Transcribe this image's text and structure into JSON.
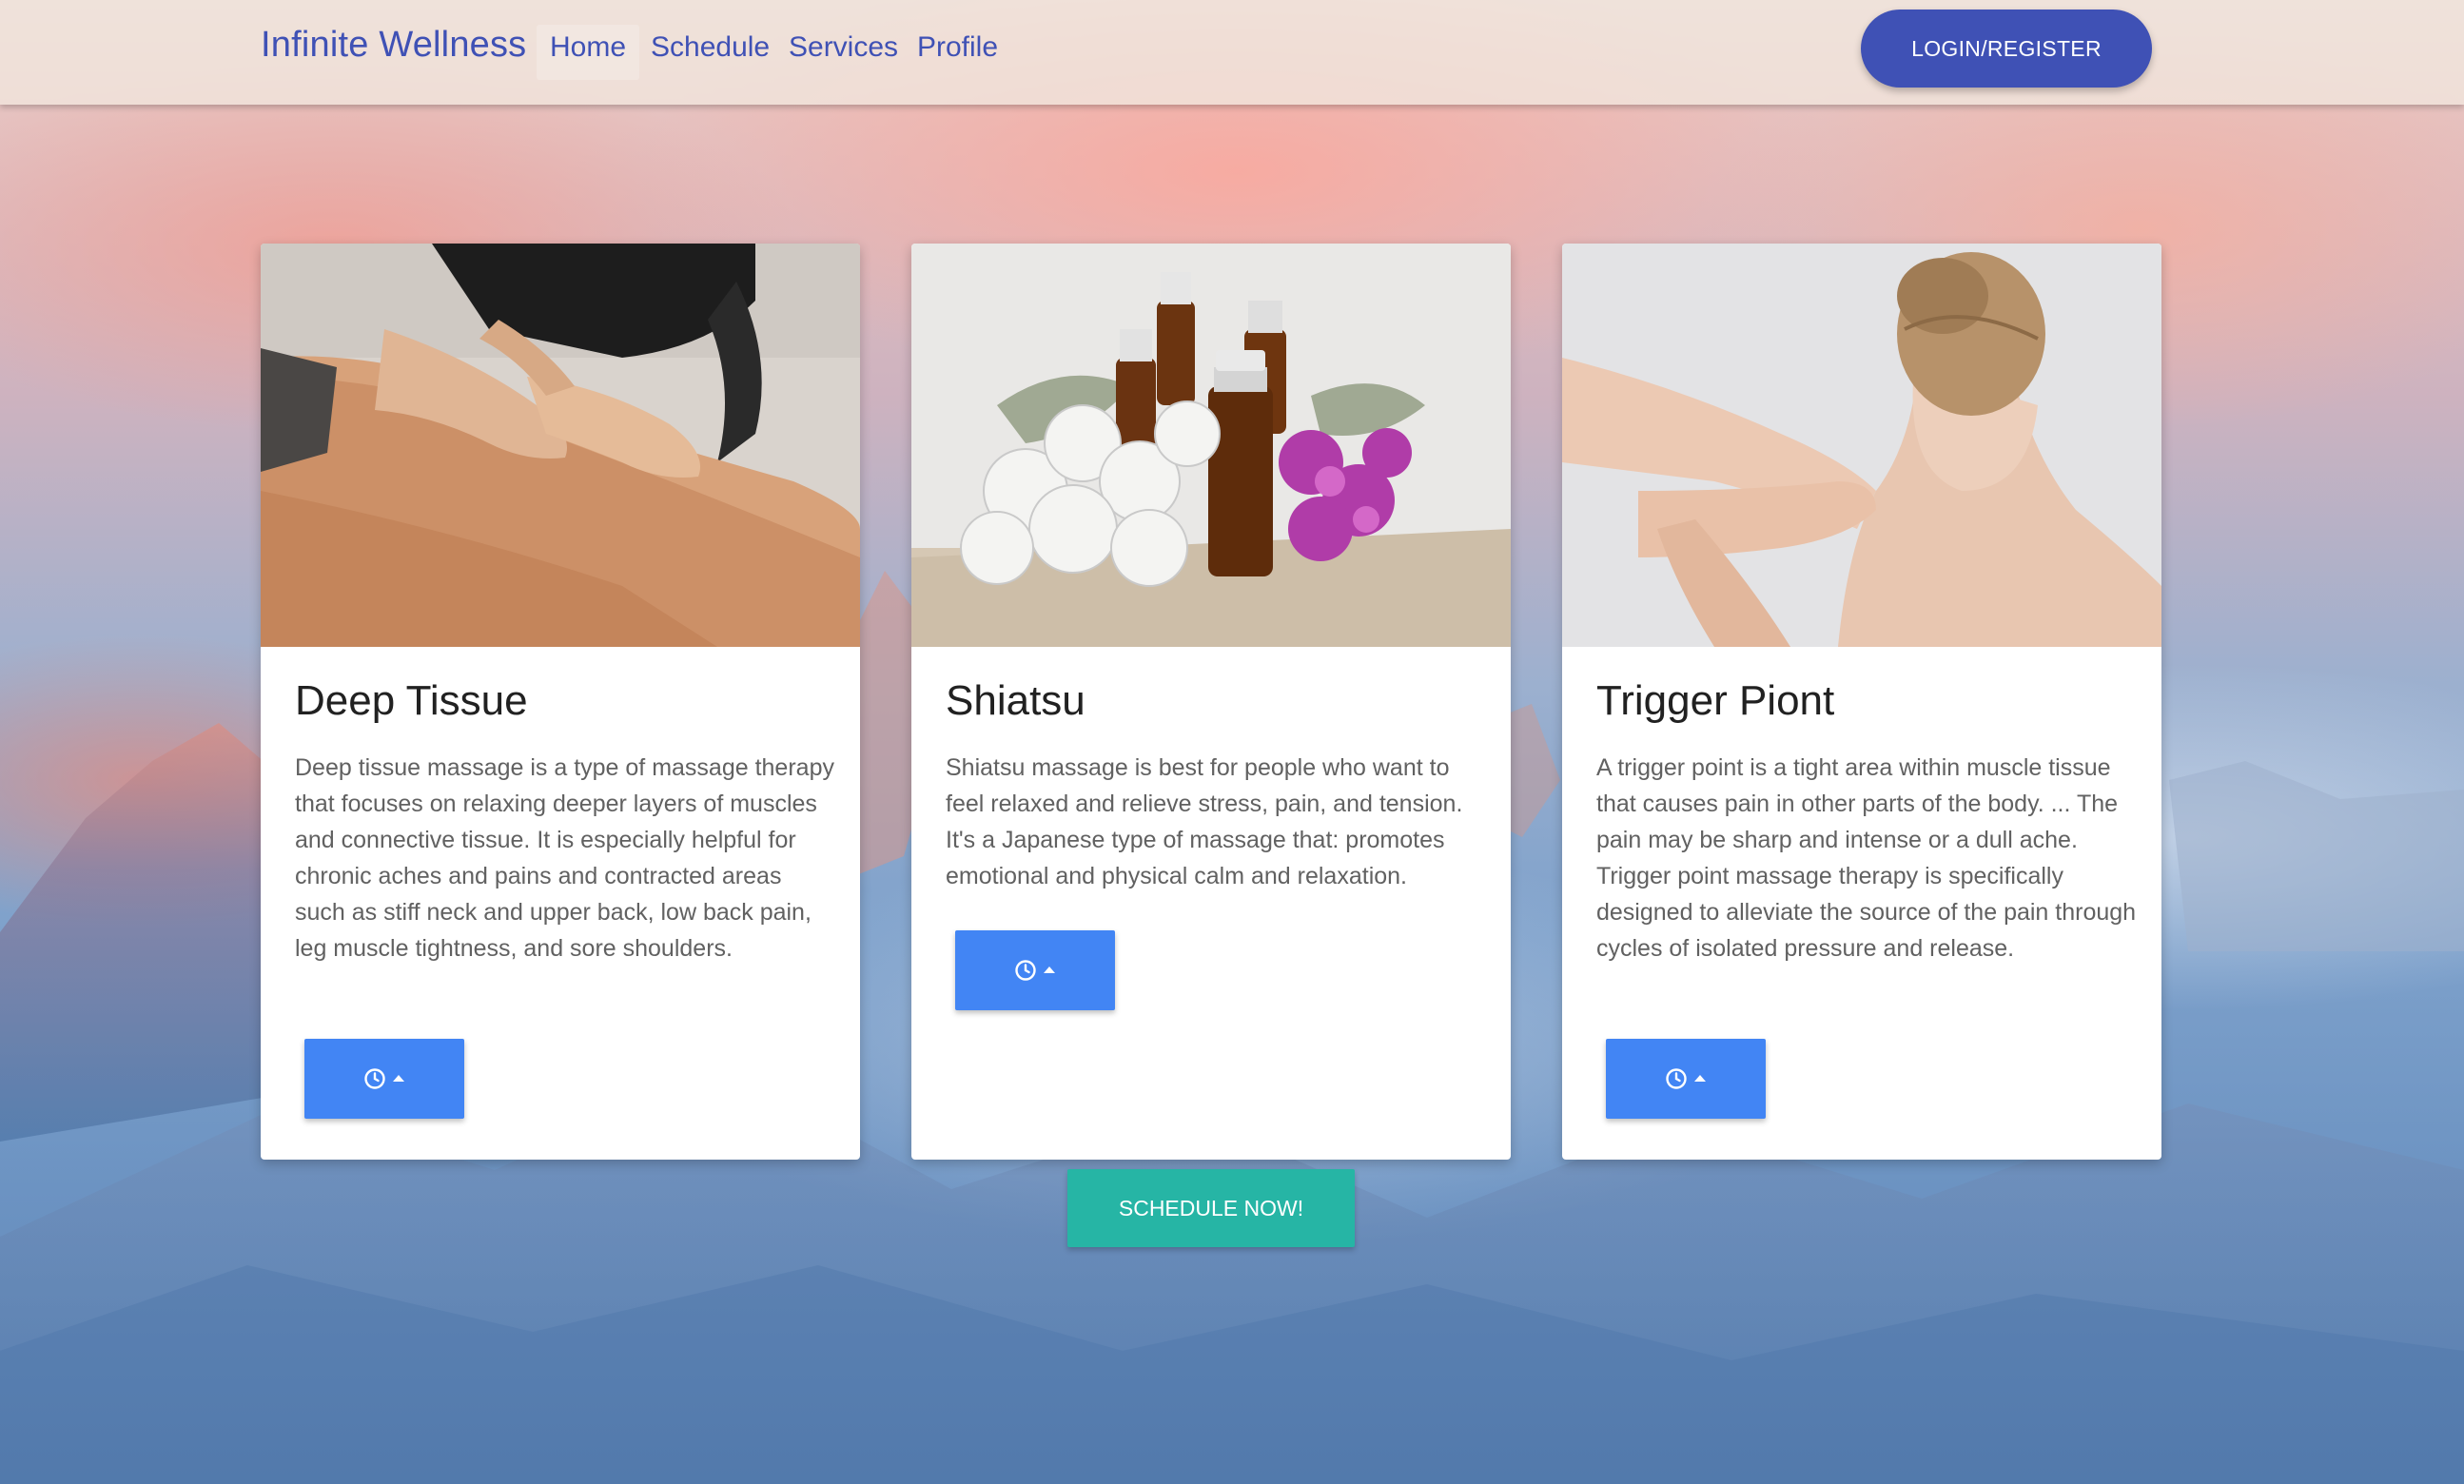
{
  "colors": {
    "primary": "#3f51b5",
    "card_button": "#4285f4",
    "schedule_button": "#26b5a5"
  },
  "navbar": {
    "brand": "Infinite Wellness",
    "links": [
      {
        "label": "Home",
        "active": true
      },
      {
        "label": "Schedule",
        "active": false
      },
      {
        "label": "Services",
        "active": false
      },
      {
        "label": "Profile",
        "active": false
      }
    ],
    "login_label": "LOGIN/REGISTER"
  },
  "cards": [
    {
      "title": "Deep Tissue",
      "description": "Deep tissue massage is a type of massage therapy that focuses on relaxing deeper layers of muscles and connective tissue. It is especially helpful for chronic aches and pains and contracted areas such as stiff neck and upper back, low back pain, leg muscle tightness, and sore shoulders.",
      "button_icons": [
        "clock-icon",
        "caret-up-icon"
      ]
    },
    {
      "title": "Shiatsu",
      "description": "Shiatsu massage is best for people who want to feel relaxed and relieve stress, pain, and tension. It's a Japanese type of massage that: promotes emotional and physical calm and relaxation.",
      "button_icons": [
        "clock-icon",
        "caret-up-icon"
      ]
    },
    {
      "title": "Trigger Piont",
      "description": "A trigger point is a tight area within muscle tissue that causes pain in other parts of the body. ... The pain may be sharp and intense or a dull ache. Trigger point massage therapy is specifically designed to alleviate the source of the pain through cycles of isolated pressure and release.",
      "button_icons": [
        "clock-icon",
        "caret-up-icon"
      ]
    }
  ],
  "schedule_label": "SCHEDULE NOW!"
}
